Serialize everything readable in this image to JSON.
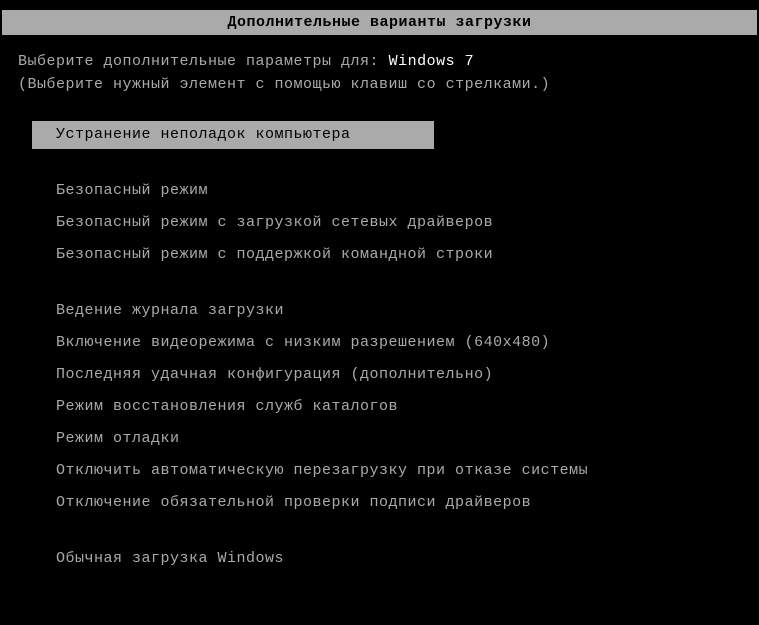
{
  "header": {
    "title": "Дополнительные варианты загрузки"
  },
  "prompt": {
    "prefix": "Выберите дополнительные параметры для: ",
    "os": "Windows 7"
  },
  "hint": "(Выберите нужный элемент с помощью клавиш со стрелками.)",
  "menu": {
    "group1": [
      "Устранение неполадок компьютера"
    ],
    "group2": [
      "Безопасный режим",
      "Безопасный режим с загрузкой сетевых драйверов",
      "Безопасный режим с поддержкой командной строки"
    ],
    "group3": [
      "Ведение журнала загрузки",
      "Включение видеорежима с низким разрешением (640x480)",
      "Последняя удачная конфигурация (дополнительно)",
      "Режим восстановления служб каталогов",
      "Режим отладки",
      "Отключить автоматическую перезагрузку при отказе системы",
      "Отключение обязательной проверки подписи драйверов"
    ],
    "group4": [
      "Обычная загрузка Windows"
    ]
  }
}
